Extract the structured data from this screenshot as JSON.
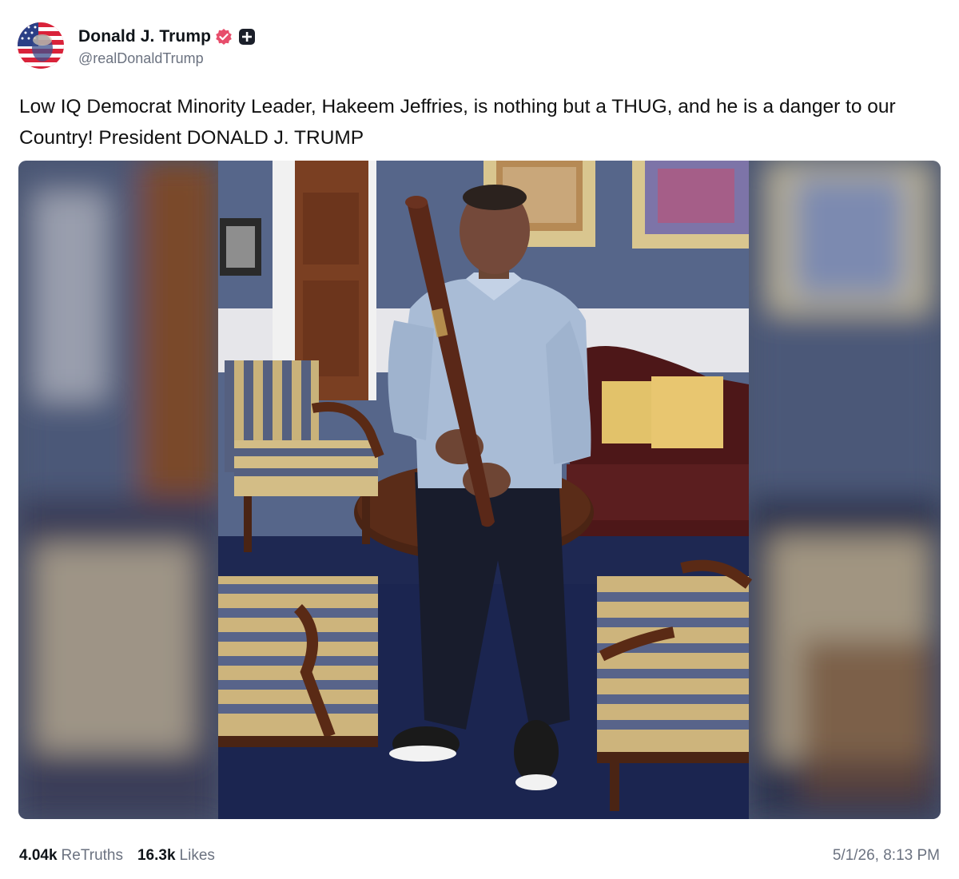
{
  "author": {
    "display_name": "Donald J. Trump",
    "handle": "@realDonaldTrump",
    "avatar_icon": "american-flag-portrait",
    "verified_icon": "verified-badge-icon",
    "verified_color": "#e74d6b",
    "badge_icon": "plus-square-icon"
  },
  "post": {
    "text": "Low IQ Democrat Minority Leader, Hakeem Jeffries, is nothing but a THUG, and he is a danger to our Country! President DONALD J. TRUMP"
  },
  "stats": {
    "retruths_count": "4.04k",
    "retruths_label": "ReTruths",
    "likes_count": "16.3k",
    "likes_label": "Likes"
  },
  "timestamp": "5/1/26, 8:13 PM"
}
